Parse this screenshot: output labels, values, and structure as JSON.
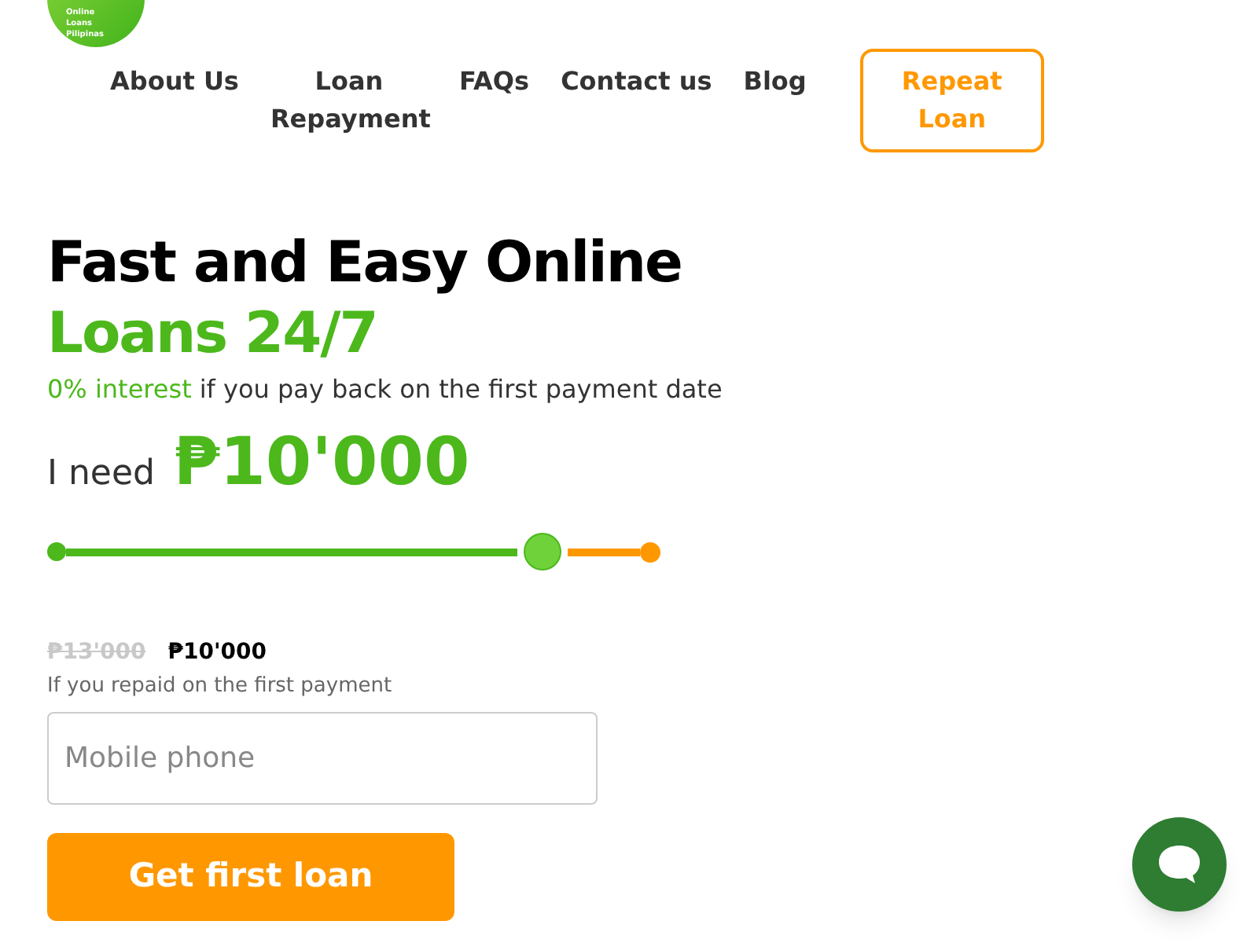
{
  "logo": {
    "text": "Online Loans Pilipinas"
  },
  "nav": [
    {
      "label": "About Us",
      "kind": "link"
    },
    {
      "label": "Loan Repayment",
      "kind": "link"
    },
    {
      "label": "FAQs",
      "kind": "link"
    },
    {
      "label": "Contact us",
      "kind": "link"
    },
    {
      "label": "Blog",
      "kind": "link"
    },
    {
      "label": "Repeat Loan",
      "kind": "outline"
    }
  ],
  "hero": {
    "title": "Fast and Easy Online",
    "title_accent": "Loans 24/7",
    "subtitle_accent": "0% interest",
    "subtitle": "if you pay back on the first payment date"
  },
  "amount": {
    "label": "I need",
    "value": "₱10'000"
  },
  "slider": {
    "level": 0.83
  },
  "prices": {
    "old": "₱13'000",
    "new": "₱10'000",
    "note": "If you repaid on the first payment"
  },
  "phone": {
    "placeholder": "Mobile phone"
  },
  "submit": "Get first loan"
}
